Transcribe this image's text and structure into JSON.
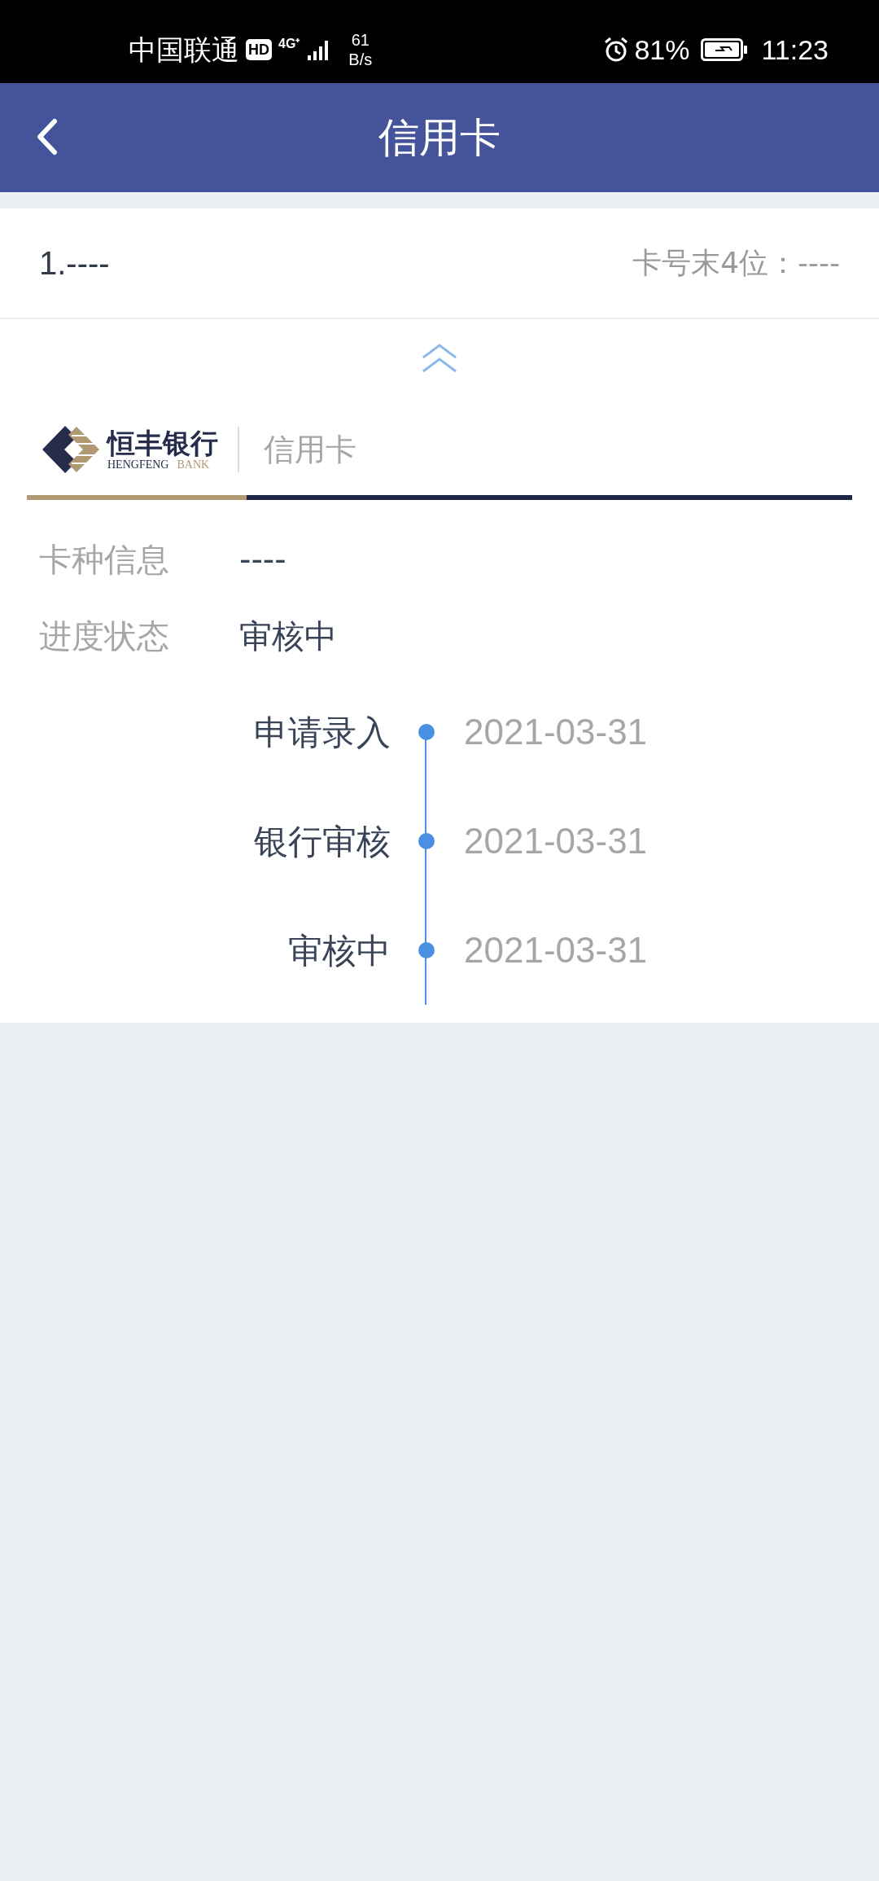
{
  "status_bar": {
    "carrier": "中国联通",
    "hd": "HD",
    "network": "4G⁺",
    "speed_value": "61",
    "speed_unit": "B/s",
    "battery": "81%",
    "time": "11:23"
  },
  "header": {
    "title": "信用卡"
  },
  "card_row": {
    "index": "1.----",
    "tail_label": "卡号末4位：----"
  },
  "expand": {
    "expanded": true
  },
  "bank": {
    "name_cn": "恒丰银行",
    "name_en_1": "HENGFENG",
    "name_en_2": "BANK",
    "product": "信用卡"
  },
  "info": [
    {
      "label": "卡种信息",
      "value": "----"
    },
    {
      "label": "进度状态",
      "value": "审核中"
    }
  ],
  "timeline": [
    {
      "step": "申请录入",
      "date": "2021-03-31"
    },
    {
      "step": "银行审核",
      "date": "2021-03-31"
    },
    {
      "step": "审核中",
      "date": "2021-03-31"
    }
  ]
}
